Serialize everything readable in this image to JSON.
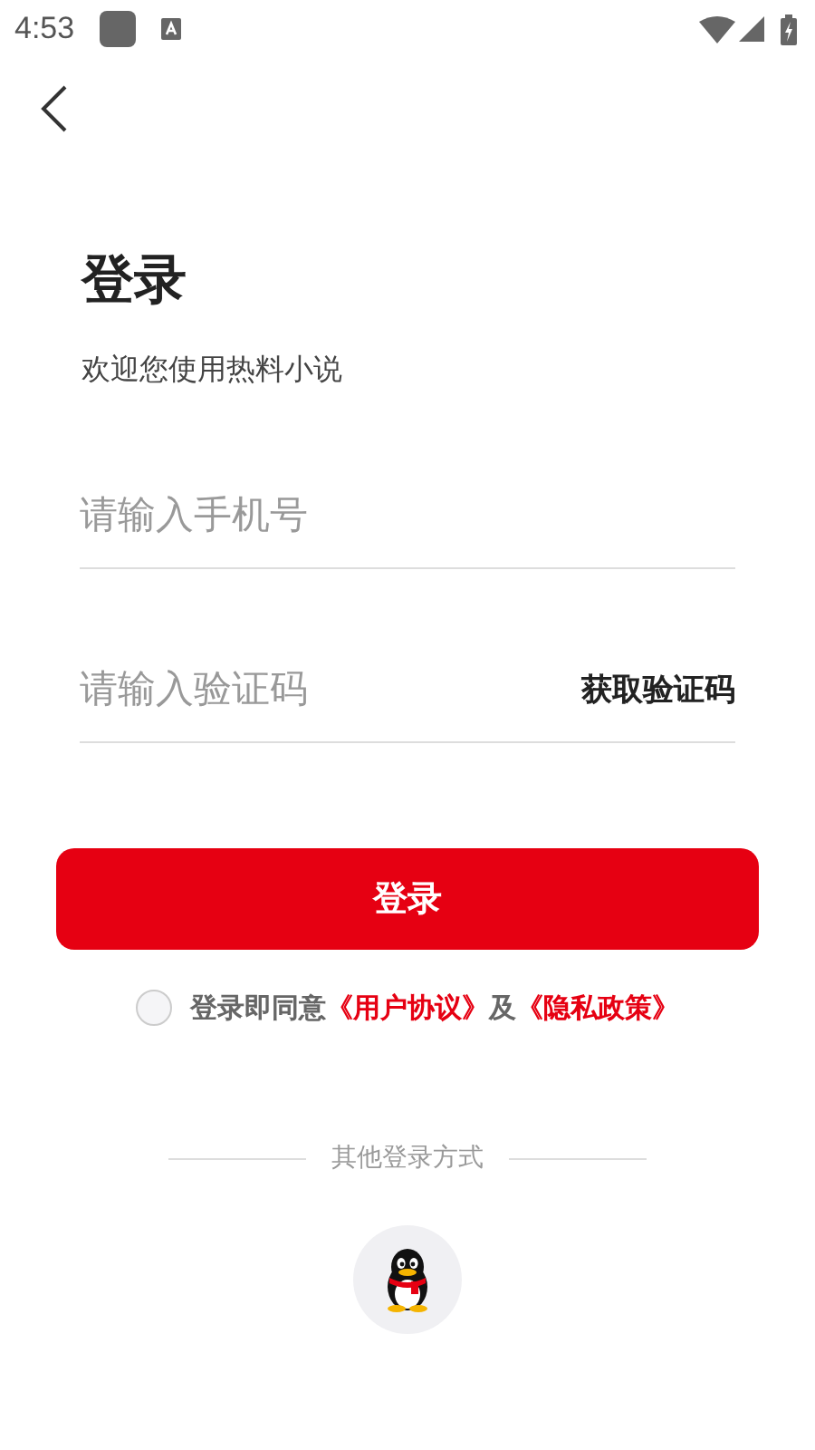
{
  "status_bar": {
    "time": "4:53"
  },
  "title": "登录",
  "subtitle": "欢迎您使用热料小说",
  "fields": [
    {
      "kind": "phone",
      "placeholder": "请输入手机号"
    },
    {
      "kind": "code",
      "placeholder": "请输入验证码",
      "action": "获取验证码"
    }
  ],
  "login_button": "登录",
  "agreement": {
    "checked": false,
    "parts": [
      {
        "kind": "text",
        "text": "登录即同意"
      },
      {
        "kind": "link",
        "text": "《用户协议》"
      },
      {
        "kind": "text",
        "text": "及"
      },
      {
        "kind": "link",
        "text": "《隐私政策》"
      }
    ]
  },
  "other_login": {
    "label": "其他登录方式"
  }
}
